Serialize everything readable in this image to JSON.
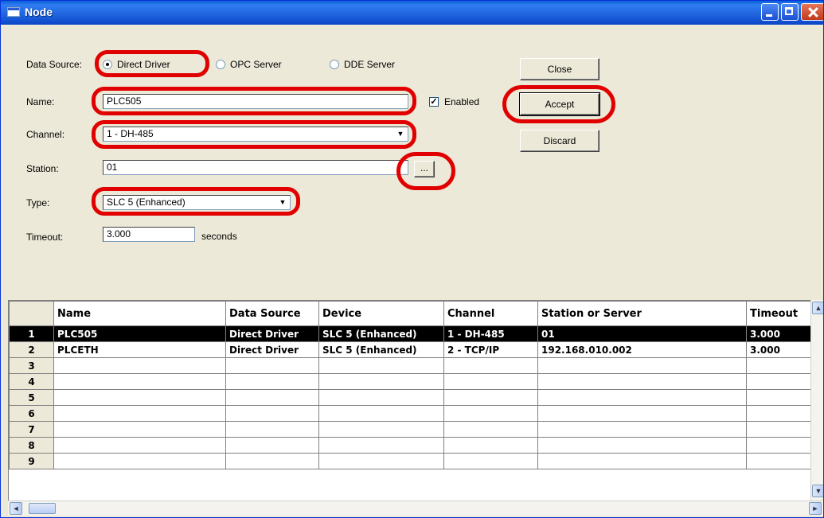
{
  "window": {
    "title": "Node",
    "accent": "#0a5fd8",
    "highlight_color": "#e00000"
  },
  "form": {
    "data_source_label": "Data Source:",
    "radios": [
      {
        "label": "Direct Driver",
        "selected": true
      },
      {
        "label": "OPC Server",
        "selected": false
      },
      {
        "label": "DDE Server",
        "selected": false
      }
    ],
    "name_label": "Name:",
    "name_value": "PLC505",
    "enabled_label": "Enabled",
    "enabled_checked": true,
    "enabled_mark": "✓",
    "channel_label": "Channel:",
    "channel_value": "1 - DH-485",
    "station_label": "Station:",
    "station_value": "01",
    "browse_label": "...",
    "type_label": "Type:",
    "type_value": "SLC 5 (Enhanced)",
    "timeout_label": "Timeout:",
    "timeout_value": "3.000",
    "timeout_unit": "seconds"
  },
  "buttons": {
    "close": "Close",
    "accept": "Accept",
    "discard": "Discard"
  },
  "grid": {
    "columns": [
      "Name",
      "Data Source",
      "Device",
      "Channel",
      "Station or Server",
      "Timeout"
    ],
    "rows": [
      {
        "num": "1",
        "cells": [
          "PLC505",
          "Direct Driver",
          "SLC 5 (Enhanced)",
          "1 - DH-485",
          "01",
          "3.000"
        ],
        "selected": true
      },
      {
        "num": "2",
        "cells": [
          "PLCETH",
          "Direct Driver",
          "SLC 5 (Enhanced)",
          "2 - TCP/IP",
          "192.168.010.002",
          "3.000"
        ]
      },
      {
        "num": "3",
        "cells": [
          "",
          "",
          "",
          "",
          "",
          ""
        ]
      },
      {
        "num": "4",
        "cells": [
          "",
          "",
          "",
          "",
          "",
          ""
        ]
      },
      {
        "num": "5",
        "cells": [
          "",
          "",
          "",
          "",
          "",
          ""
        ]
      },
      {
        "num": "6",
        "cells": [
          "",
          "",
          "",
          "",
          "",
          ""
        ]
      },
      {
        "num": "7",
        "cells": [
          "",
          "",
          "",
          "",
          "",
          ""
        ]
      },
      {
        "num": "8",
        "cells": [
          "",
          "",
          "",
          "",
          "",
          ""
        ]
      },
      {
        "num": "9",
        "cells": [
          "",
          "",
          "",
          "",
          "",
          ""
        ]
      }
    ]
  },
  "icons": {
    "window": "app-window-icon",
    "up": "▲",
    "down": "▼",
    "left": "◄",
    "right": "►",
    "combo": "▼"
  }
}
